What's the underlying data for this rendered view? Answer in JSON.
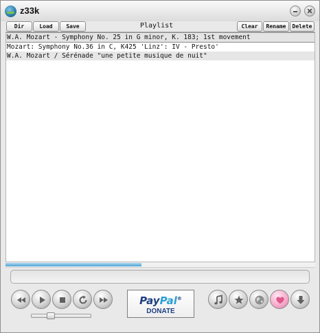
{
  "window": {
    "title": "z33k"
  },
  "toolbar": {
    "dir_label": "Dir",
    "load_label": "Load",
    "save_label": "Save",
    "playlist_label": "Playlist",
    "clear_label": "Clear",
    "rename_label": "Rename",
    "delete_label": "Delete"
  },
  "playlist": {
    "items": [
      "W.A. Mozart - Symphony No. 25 in G minor, K. 183; 1st movement",
      "Mozart: Symphony No.36 in C, K425 'Linz': IV - Presto'",
      "W.A. Mozart / Sérénade \"une petite musique de nuit\""
    ],
    "selected_index": 0
  },
  "playback": {
    "progress_percent": 44,
    "volume_fraction": 0.3,
    "status_text": ""
  },
  "controls": {
    "icons": [
      "rewind-icon",
      "play-icon",
      "stop-icon",
      "repeat-icon",
      "fast-forward-icon",
      "music-note-icon",
      "star-icon",
      "globe-icon",
      "heart-icon",
      "download-icon"
    ]
  },
  "donate": {
    "brand_pay": "Pay",
    "brand_pal": "Pal",
    "trademark": "®",
    "label": "DONATE"
  },
  "colors": {
    "progress_fill": "#4ea3d4",
    "paypal_dark": "#1d3f82",
    "paypal_light": "#2ba0d8",
    "heart_accent": "#f5a9c9"
  }
}
